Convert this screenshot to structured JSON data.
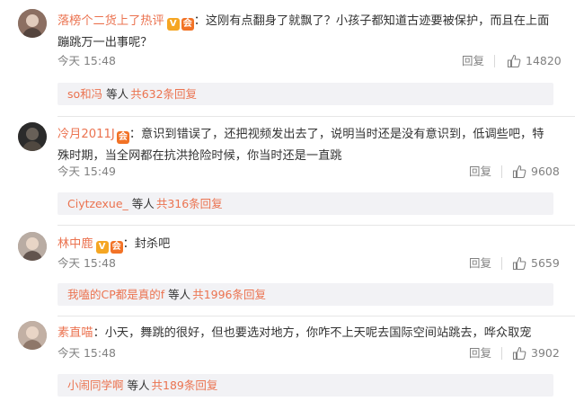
{
  "comments": [
    {
      "username": "落榜个二货上了热评",
      "has_member_badge": true,
      "text": "这刚有点翻身了就飘了？小孩子都知道古迹要被保护，而且在上面蹦跳万一出事呢？",
      "time": "今天 15:48",
      "reply_label": "回复",
      "likes": "14820",
      "replies": {
        "name": "so和冯",
        "etc": "等人",
        "count_text": "共632条回复"
      },
      "avatar_color": "#8c6f62"
    },
    {
      "username": "冷月2011J",
      "has_member_badge": false,
      "text": "意识到错误了，还把视频发出去了，说明当时还是没有意识到，低调些吧，特殊时期，当全网都在抗洪抢险时候，你当时还是一直跳",
      "time": "今天 15:49",
      "reply_label": "回复",
      "likes": "9608",
      "replies": {
        "name": "Ciytzexue_",
        "etc": "等人",
        "count_text": "共316条回复"
      },
      "avatar_color": "#2b2b2b"
    },
    {
      "username": "林中鹿",
      "has_member_badge": true,
      "text": "封杀吧",
      "time": "今天 15:48",
      "reply_label": "回复",
      "likes": "5659",
      "replies": {
        "name": "我嗑的CP都是真的f",
        "etc": "等人",
        "count_text": "共1996条回复"
      },
      "avatar_color": "#b9aca3"
    },
    {
      "username": "素直喵",
      "has_member_badge": false,
      "text": "小天，舞跳的很好，但也要选对地方，你咋不上天呢去国际空间站跳去，哗众取宠",
      "time": "今天 15:48",
      "reply_label": "回复",
      "likes": "3902",
      "replies": {
        "name": "小闹同学啊",
        "etc": "等人",
        "count_text": "共189条回复"
      },
      "avatar_color": "#c2b0a4"
    }
  ]
}
